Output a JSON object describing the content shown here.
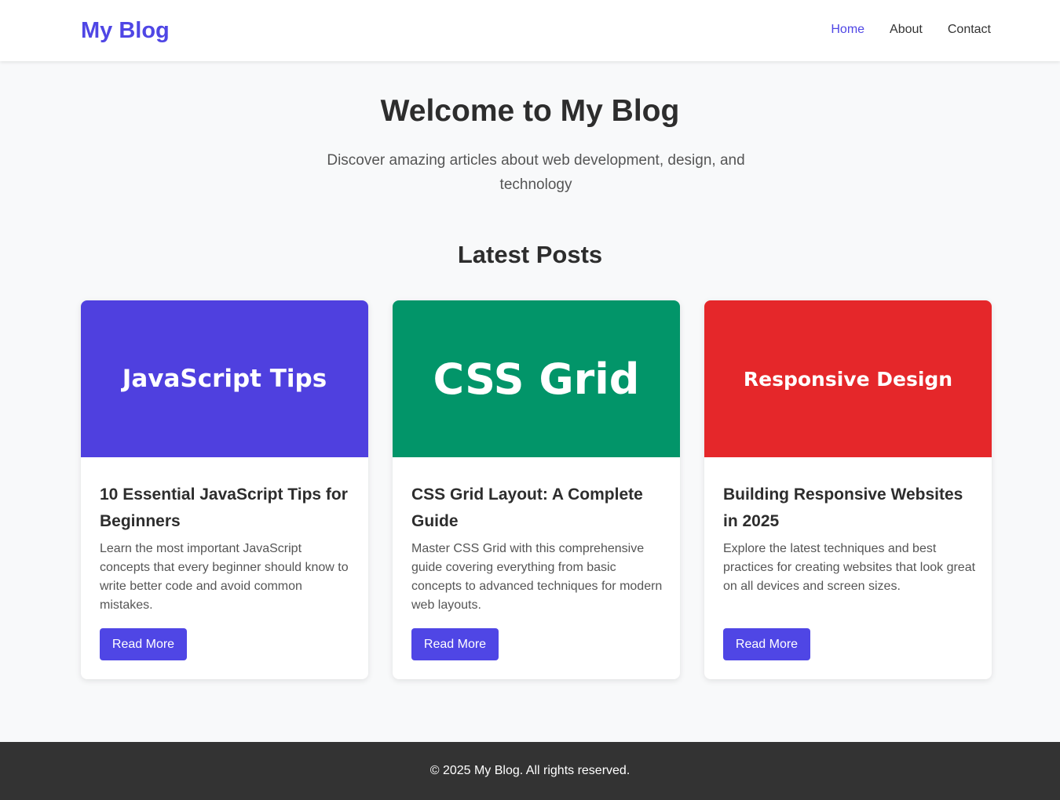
{
  "header": {
    "logo": "My Blog",
    "nav": [
      {
        "label": "Home",
        "active": true
      },
      {
        "label": "About",
        "active": false
      },
      {
        "label": "Contact",
        "active": false
      }
    ]
  },
  "hero": {
    "title": "Welcome to My Blog",
    "subtitle": "Discover amazing articles about web development, design, and technology"
  },
  "posts_section": {
    "title": "Latest Posts",
    "posts": [
      {
        "image_label": "JavaScript Tips",
        "image_color": "#4f40df",
        "title": "10 Essential JavaScript Tips for Beginners",
        "excerpt": "Learn the most important JavaScript concepts that every beginner should know to write better code and avoid common mistakes.",
        "button": "Read More"
      },
      {
        "image_label": "CSS Grid",
        "image_color": "#029569",
        "title": "CSS Grid Layout: A Complete Guide",
        "excerpt": "Master CSS Grid with this comprehensive guide covering everything from basic concepts to advanced techniques for modern web layouts.",
        "button": "Read More"
      },
      {
        "image_label": "Responsive Design",
        "image_color": "#e5272a",
        "title": "Building Responsive Websites in 2025",
        "excerpt": "Explore the latest techniques and best practices for creating websites that look great on all devices and screen sizes.",
        "button": "Read More"
      }
    ]
  },
  "footer": {
    "text": "© 2025 My Blog. All rights reserved."
  },
  "colors": {
    "accent": "#4f46e5",
    "footer_bg": "#333333",
    "page_bg": "#f8f9fa"
  }
}
